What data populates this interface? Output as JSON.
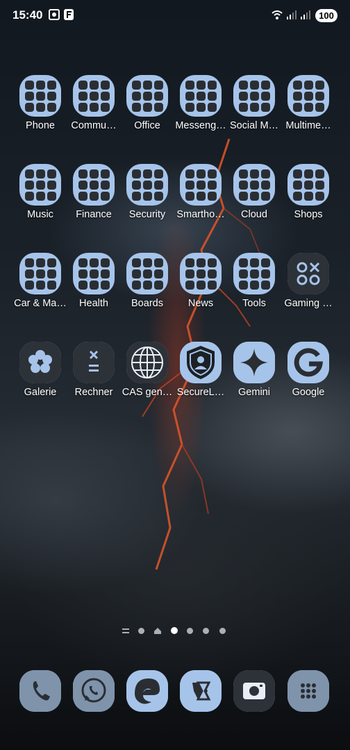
{
  "status_bar": {
    "time": "15:40",
    "battery": "100"
  },
  "rows": [
    [
      {
        "label": "Phone",
        "type": "folder"
      },
      {
        "label": "Commu…",
        "type": "folder"
      },
      {
        "label": "Office",
        "type": "folder"
      },
      {
        "label": "Messeng…",
        "type": "folder"
      },
      {
        "label": "Social M…",
        "type": "folder"
      },
      {
        "label": "Multime…",
        "type": "folder"
      }
    ],
    [
      {
        "label": "Music",
        "type": "folder"
      },
      {
        "label": "Finance",
        "type": "folder"
      },
      {
        "label": "Security",
        "type": "folder"
      },
      {
        "label": "Smartho…",
        "type": "folder"
      },
      {
        "label": "Cloud",
        "type": "folder"
      },
      {
        "label": "Shops",
        "type": "folder"
      }
    ],
    [
      {
        "label": "Car & Ma…",
        "type": "folder"
      },
      {
        "label": "Health",
        "type": "folder"
      },
      {
        "label": "Boards",
        "type": "folder"
      },
      {
        "label": "News",
        "type": "folder"
      },
      {
        "label": "Tools",
        "type": "folder"
      },
      {
        "label": "Gaming …",
        "type": "app",
        "icon": "gaming-icon"
      }
    ],
    [
      {
        "label": "Galerie",
        "type": "app",
        "icon": "flower-icon"
      },
      {
        "label": "Rechner",
        "type": "app",
        "icon": "calculator-icon"
      },
      {
        "label": "CAS gen…",
        "type": "app",
        "icon": "globe-icon"
      },
      {
        "label": "SecureL…",
        "type": "app",
        "icon": "shield-person-icon"
      },
      {
        "label": "Gemini",
        "type": "app",
        "icon": "sparkle-icon"
      },
      {
        "label": "Google",
        "type": "app",
        "icon": "google-g-icon"
      }
    ]
  ],
  "dock": [
    {
      "name": "phone-app",
      "icon": "phone-handset-icon"
    },
    {
      "name": "whatsapp-app",
      "icon": "whatsapp-icon"
    },
    {
      "name": "edge-app",
      "icon": "edge-browser-icon"
    },
    {
      "name": "copilot-app",
      "icon": "copilot-icon"
    },
    {
      "name": "camera-app",
      "icon": "camera-icon"
    },
    {
      "name": "app-drawer",
      "icon": "grid-dots-icon"
    }
  ],
  "pager": {
    "pages": 6,
    "active": 3
  },
  "colors": {
    "icon_bg": "#a6c4ea",
    "dark_icon_bg": "#2d3238",
    "glyph": "#2a2e33"
  }
}
